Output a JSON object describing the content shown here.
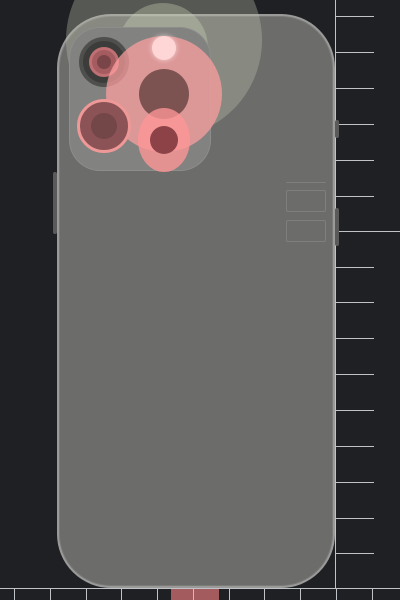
{
  "colors": {
    "background": "#1f2023",
    "phone_body": "#6c6c6b",
    "phone_edge": "#9a9a99",
    "camera_bump": "#828280",
    "ruler": "#bfc2c6",
    "selection_marker": "#a35b5e",
    "lens_highlight": "#ff9f9f"
  },
  "icons": {
    "phone": "phone-back-icon",
    "camera_wide": "camera-lens-icon",
    "camera_ultrawide": "camera-lens-icon",
    "camera_tele": "camera-lens-icon",
    "flash": "flash-icon",
    "lidar": "lidar-sensor-icon"
  }
}
